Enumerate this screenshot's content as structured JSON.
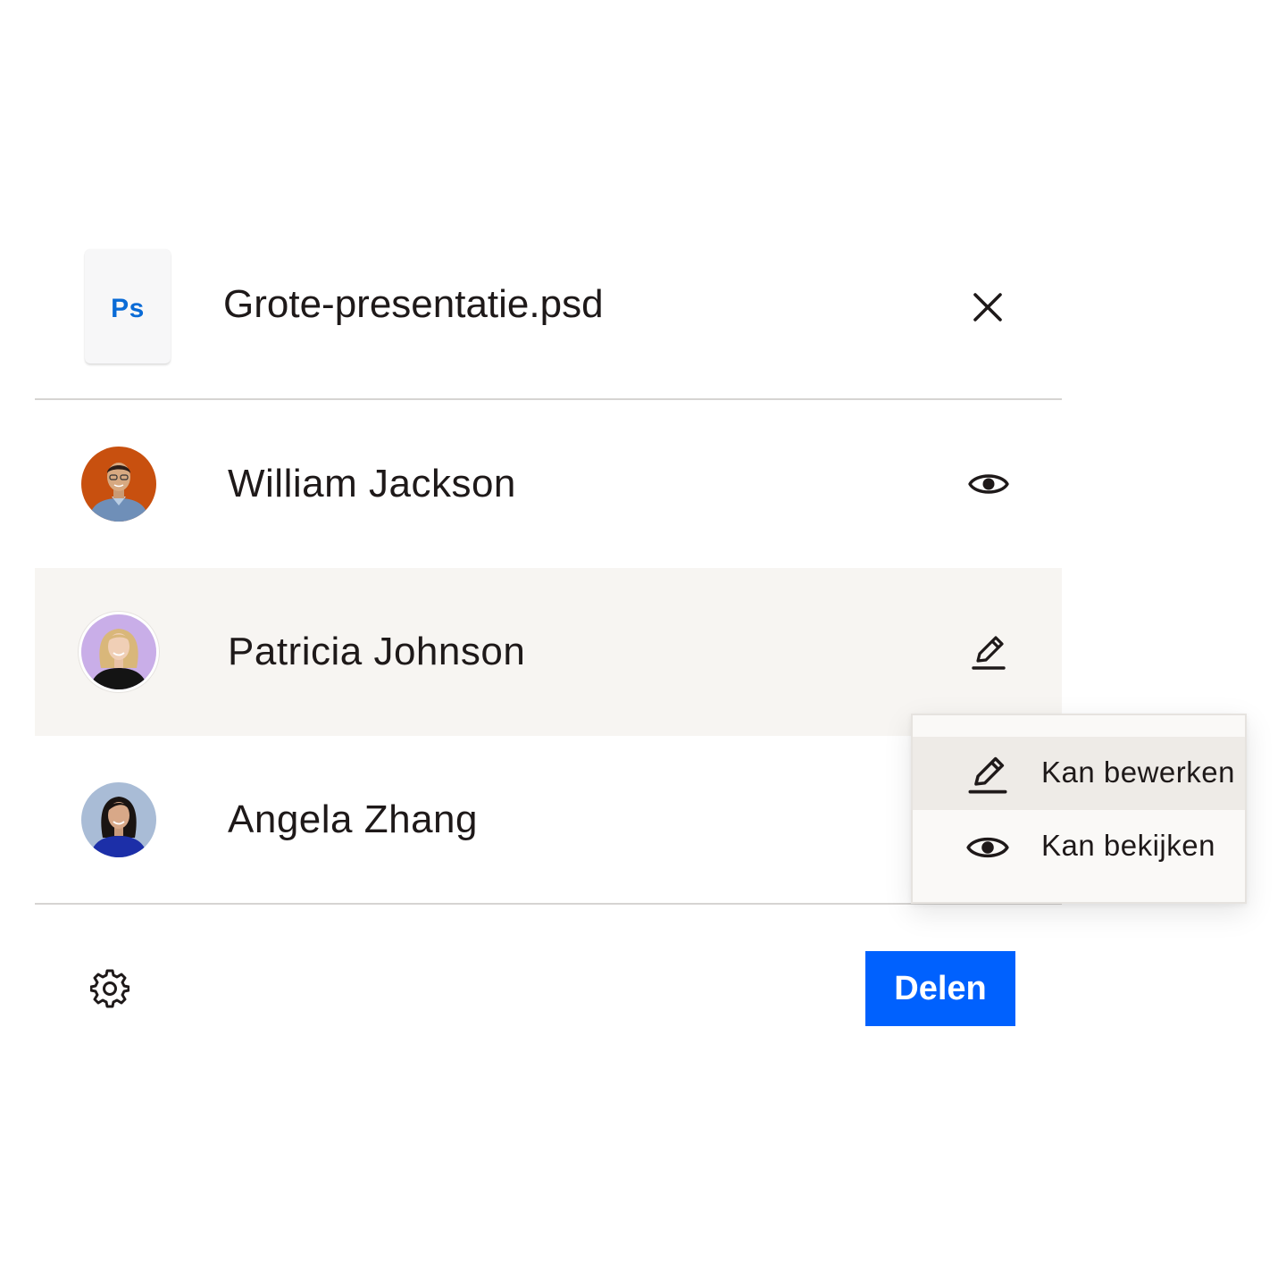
{
  "dialog": {
    "file": {
      "thumbnail_label": "Ps",
      "name": "Grote-presentatie.psd",
      "thumbnail_icon": "photoshop-file-icon",
      "close_icon": "close-icon"
    },
    "members": [
      {
        "name": "William Jackson",
        "permission_icon": "eye-icon",
        "avatar_color": "#c8500f",
        "selected": false
      },
      {
        "name": "Patricia Johnson",
        "permission_icon": "pencil-icon",
        "avatar_color": "#c9aee8",
        "selected": true
      },
      {
        "name": "Angela Zhang",
        "permission_icon": "",
        "avatar_color": "#a9bcd6",
        "selected": false
      }
    ],
    "permission_menu": {
      "items": [
        {
          "label": "Kan bewerken",
          "icon": "pencil-icon",
          "highlighted": true
        },
        {
          "label": "Kan bekijken",
          "icon": "eye-icon",
          "highlighted": false
        }
      ]
    },
    "footer": {
      "settings_icon": "gear-icon",
      "share_label": "Delen"
    },
    "colors": {
      "accent": "#0061fe",
      "text": "#1e1919",
      "selected_row": "#f7f5f2",
      "file_badge": "#0a6bd6"
    }
  }
}
